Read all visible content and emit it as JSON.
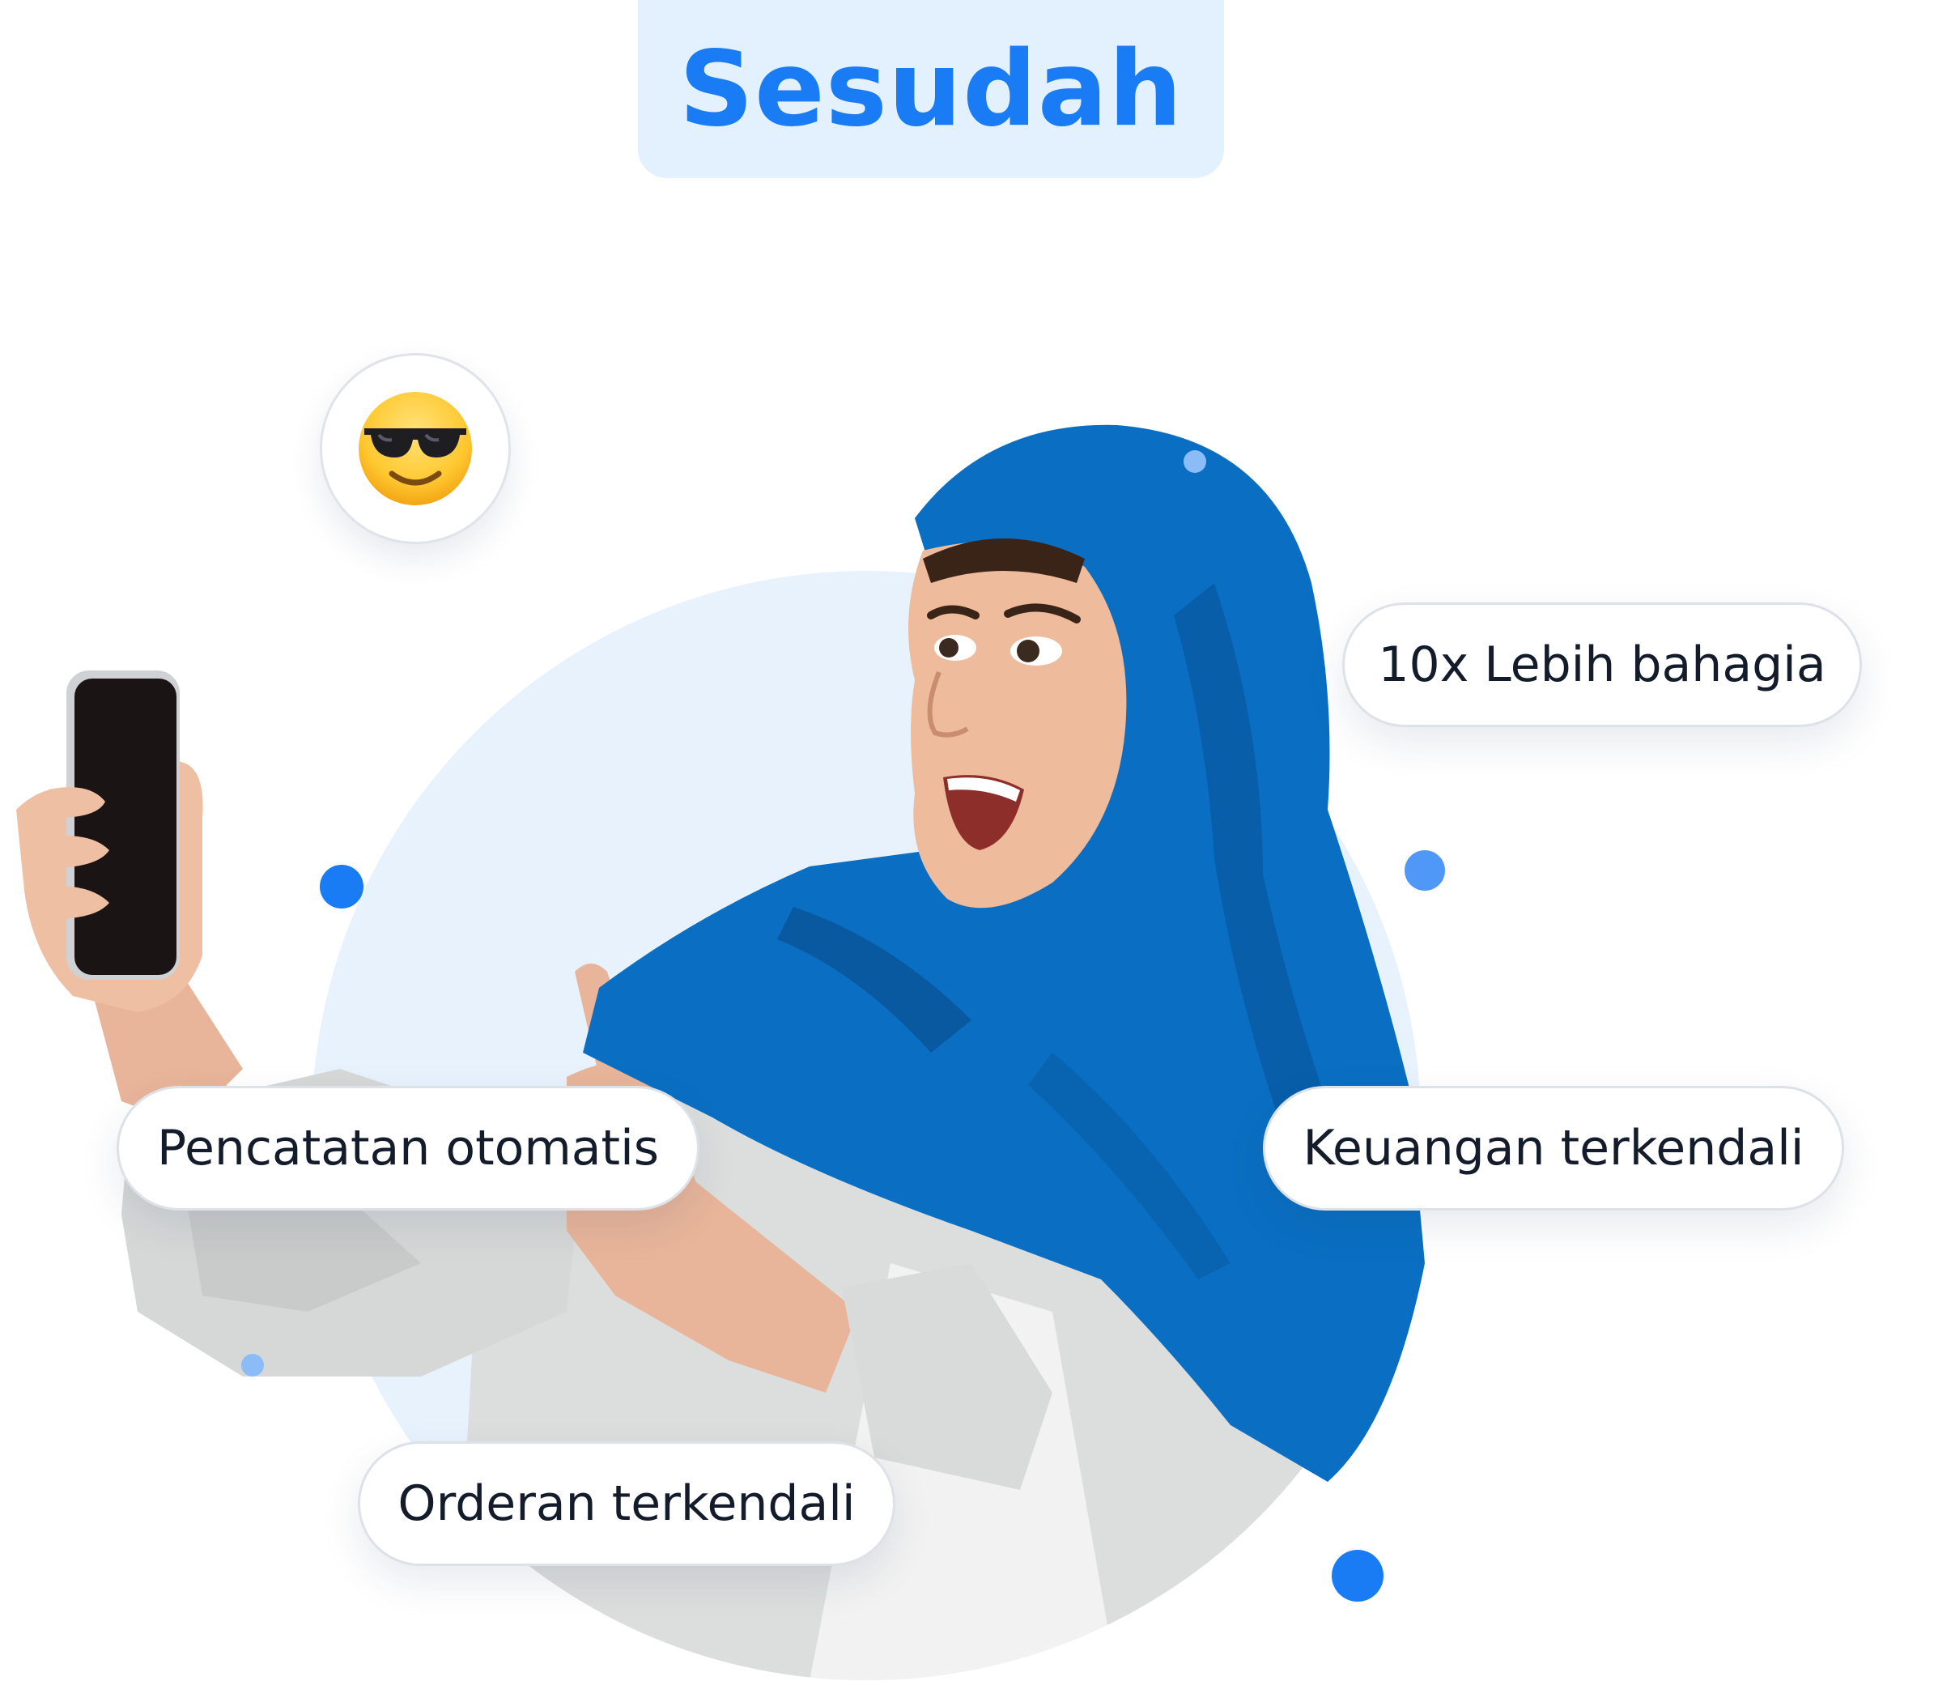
{
  "title": "Sesudah",
  "emoji_icon": "sunglasses-face-emoji",
  "features": {
    "happier": "10x Lebih bahagia",
    "auto_recording": "Pencatatan otomatis",
    "finances": "Keuangan terkendali",
    "orders": "Orderan terkendali"
  },
  "colors": {
    "accent": "#1a7cf5",
    "title_background": "#e3f0fd",
    "circle_background": "#e8f2fd",
    "hijab": "#0a6fc2",
    "dot_light": "#8cbcf8"
  }
}
